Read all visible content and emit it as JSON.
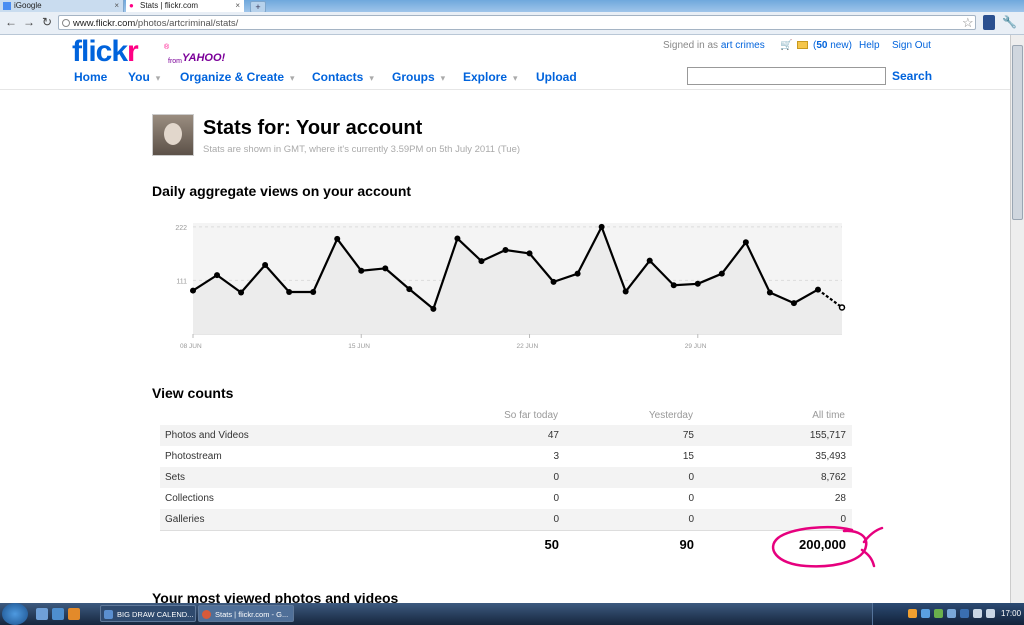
{
  "browser": {
    "tabs": [
      {
        "label": "iGoogle"
      },
      {
        "label": "Stats | flickr.com"
      }
    ],
    "new_tab": "+",
    "url_domain": "www.flickr.com",
    "url_path": "/photos/artcriminal/stats/"
  },
  "header": {
    "logo_a": "flick",
    "logo_b": "r",
    "logo_reg": "®",
    "from": "from",
    "yahoo": "YAHOO!",
    "signed_in_prefix": "Signed in as",
    "user": "art crimes",
    "new_count": "50",
    "new_suffix": "new)",
    "new_prefix": "(",
    "help": "Help",
    "sign_out": "Sign Out",
    "search_label": "Search",
    "search_value": ""
  },
  "nav": [
    {
      "label": "Home",
      "caret": false
    },
    {
      "label": "You",
      "caret": true
    },
    {
      "label": "Organize & Create",
      "caret": true
    },
    {
      "label": "Contacts",
      "caret": true
    },
    {
      "label": "Groups",
      "caret": true
    },
    {
      "label": "Explore",
      "caret": true
    },
    {
      "label": "Upload",
      "caret": false
    }
  ],
  "stats": {
    "title": "Stats for: Your account",
    "subtitle": "Stats are shown in GMT, where it's currently 3.59PM on 5th July 2011 (Tue)"
  },
  "chart_data": {
    "type": "line",
    "title": "Daily aggregate views on your account",
    "x_tick_labels": [
      "08 JUN",
      "15 JUN",
      "22 JUN",
      "29 JUN"
    ],
    "y_ticks": [
      111,
      222
    ],
    "ylim": [
      0,
      230
    ],
    "grid": true,
    "series": [
      {
        "values": [
          90,
          122,
          86,
          143,
          87,
          87,
          197,
          131,
          136,
          93,
          52,
          198,
          151,
          174,
          167,
          108,
          125,
          222,
          88,
          152,
          101,
          104,
          125,
          190,
          86,
          64,
          92
        ],
        "last_point_estimate": 55
      }
    ]
  },
  "view_counts": {
    "title": "View counts",
    "columns": [
      "So far today",
      "Yesterday",
      "All time"
    ],
    "rows": [
      {
        "name": "Photos and Videos",
        "today": "47",
        "yesterday": "75",
        "all": "155,717"
      },
      {
        "name": "Photostream",
        "today": "3",
        "yesterday": "15",
        "all": "35,493"
      },
      {
        "name": "Sets",
        "today": "0",
        "yesterday": "0",
        "all": "8,762"
      },
      {
        "name": "Collections",
        "today": "0",
        "yesterday": "0",
        "all": "28"
      },
      {
        "name": "Galleries",
        "today": "0",
        "yesterday": "0",
        "all": "0"
      }
    ],
    "totals": {
      "today": "50",
      "yesterday": "90",
      "all": "200,000"
    }
  },
  "most_viewed": {
    "title": "Your most viewed photos and videos"
  },
  "taskbar": {
    "tasks": [
      {
        "label": "BIG DRAW CALEND..."
      },
      {
        "label": "Stats | flickr.com - G..."
      }
    ],
    "clock": "17:00"
  },
  "colors": {
    "flickr_blue": "#0063dc",
    "flickr_pink": "#ff0084",
    "annotation": "#e6007e"
  }
}
